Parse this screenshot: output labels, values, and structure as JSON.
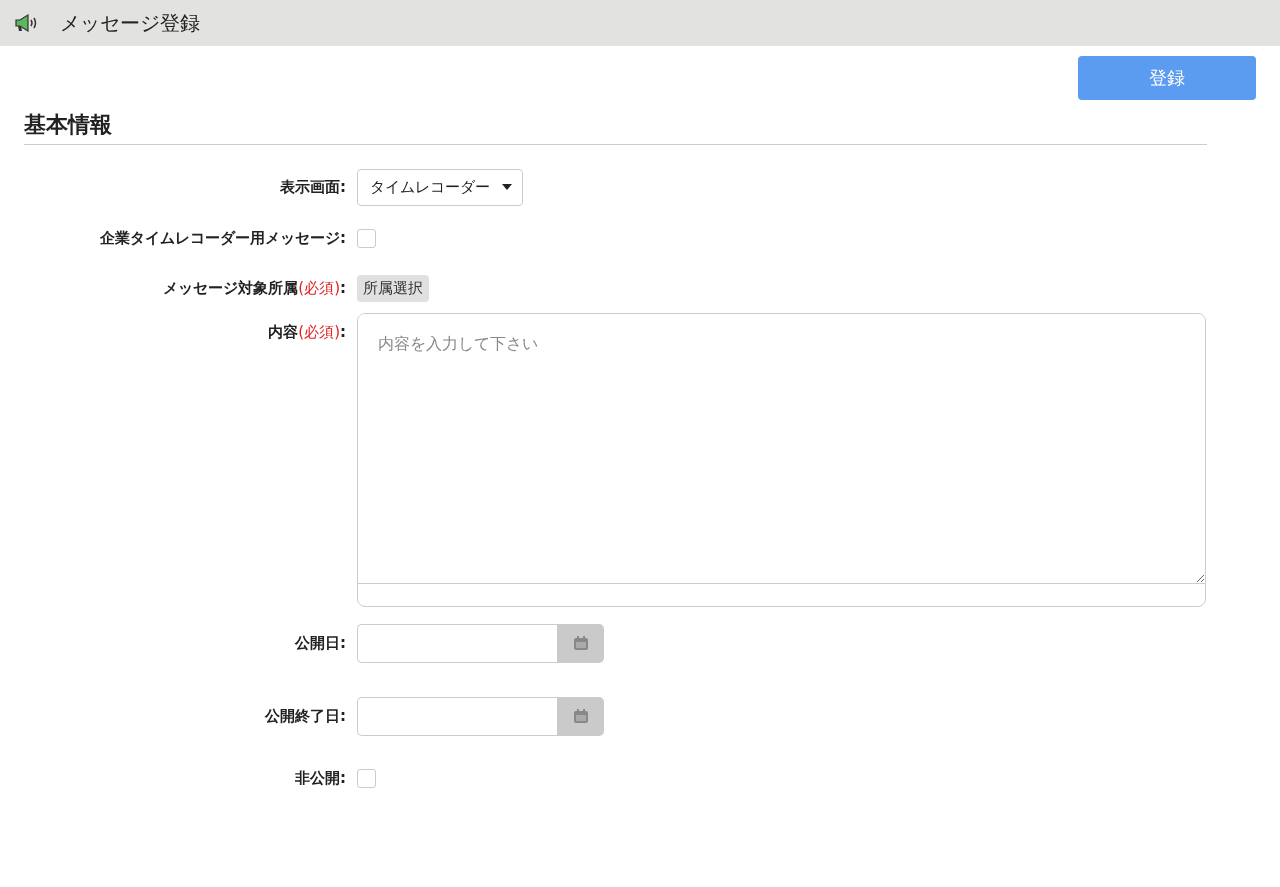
{
  "header": {
    "title": "メッセージ登録"
  },
  "submit_button": "登録",
  "section": {
    "title": "基本情報"
  },
  "fields": [
    {
      "kind": "select",
      "label": "表示画面",
      "suffix": ":",
      "value": "タイムレコーダー"
    },
    {
      "kind": "checkbox",
      "label": "企業タイムレコーダー用メッセージ",
      "suffix": ":",
      "checked": false
    },
    {
      "kind": "button",
      "label": "メッセージ対象所属",
      "required": "(必須)",
      "suffix": ":",
      "button": "所属選択"
    },
    {
      "kind": "textarea",
      "label": "内容",
      "required": "(必須)",
      "suffix": ":",
      "placeholder": "内容を入力して下さい"
    },
    {
      "kind": "date",
      "label": "公開日",
      "suffix": ":"
    },
    {
      "kind": "date",
      "label": "公開終了日",
      "suffix": ":"
    },
    {
      "kind": "checkbox",
      "label": "非公開",
      "suffix": ":",
      "checked": false
    }
  ]
}
